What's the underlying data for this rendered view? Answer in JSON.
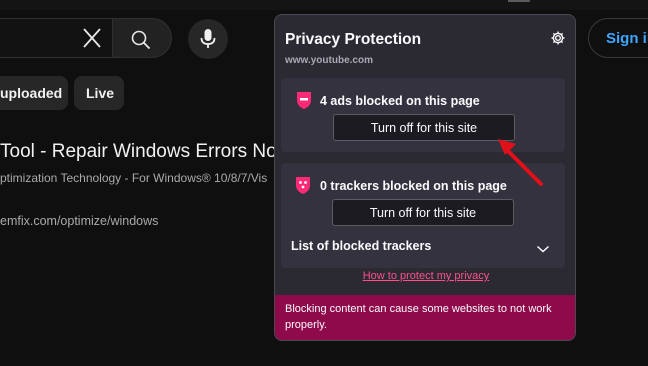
{
  "youtube": {
    "chips": [
      "uploaded",
      "Live"
    ],
    "signin_label": "Sign in",
    "result": {
      "title": "Tool - Repair Windows Errors Now",
      "description": "ptimization Technology - For Windows® 10/8/7/Vis",
      "url": "emfix.com/optimize/windows"
    }
  },
  "panel": {
    "title": "Privacy Protection",
    "site": "www.youtube.com",
    "ads": {
      "label": "4 ads blocked on this page",
      "button": "Turn off for this site"
    },
    "trackers": {
      "label": "0 trackers blocked on this page",
      "button": "Turn off for this site",
      "list_label": "List of blocked trackers"
    },
    "link": "How to protect my privacy",
    "warning": "Blocking content can cause some websites to not work properly.",
    "colors": {
      "accent": "#ff4f8b",
      "warning_bg": "#8e0a4a",
      "panel_bg": "#2b2a33"
    }
  },
  "annotation": {
    "color": "#e0101a"
  }
}
